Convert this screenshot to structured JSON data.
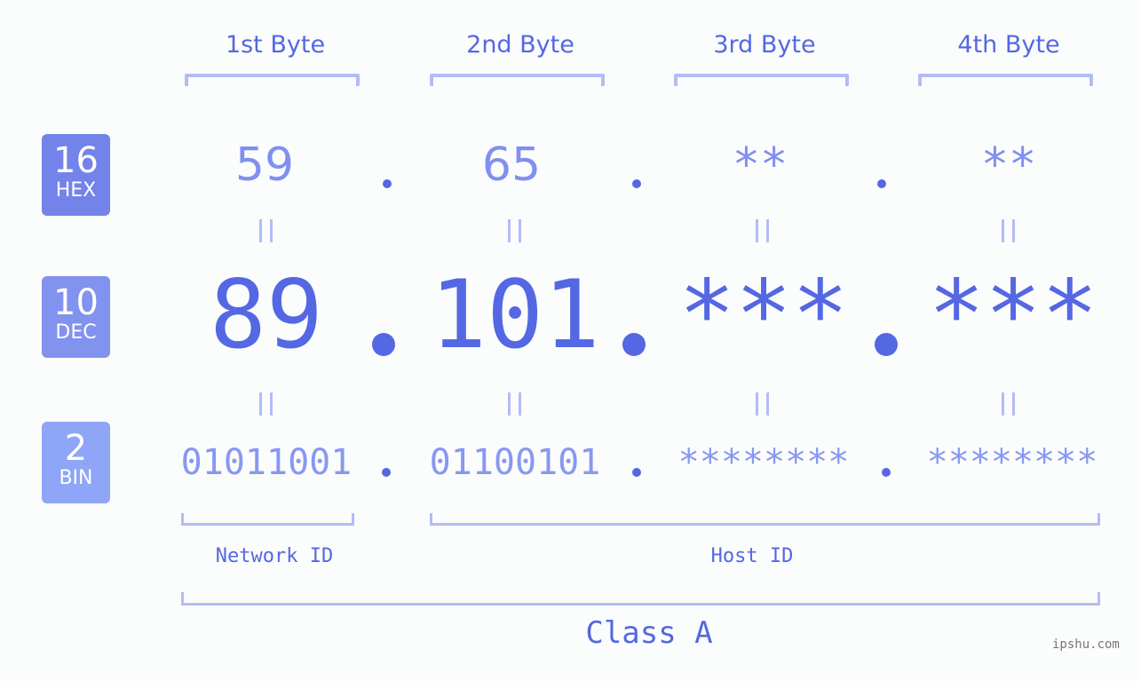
{
  "byte_headers": [
    "1st Byte",
    "2nd Byte",
    "3rd Byte",
    "4th Byte"
  ],
  "badges": [
    {
      "base": "16",
      "label": "HEX",
      "color": "#7383ea"
    },
    {
      "base": "10",
      "label": "DEC",
      "color": "#8292ef"
    },
    {
      "base": "2",
      "label": "BIN",
      "color": "#8fa5f7"
    }
  ],
  "hex": [
    "59",
    "65",
    "**",
    "**"
  ],
  "dec": [
    "89",
    "101",
    "***",
    "***"
  ],
  "bin": [
    "01011001",
    "01100101",
    "********",
    "********"
  ],
  "separator": ".",
  "network_id_label": "Network ID",
  "host_id_label": "Host ID",
  "class_label": "Class A",
  "watermark": "ipshu.com",
  "colors": {
    "accent": "#5468e3",
    "bracket": "#b3bcf6",
    "background": "#fbfcfc"
  }
}
